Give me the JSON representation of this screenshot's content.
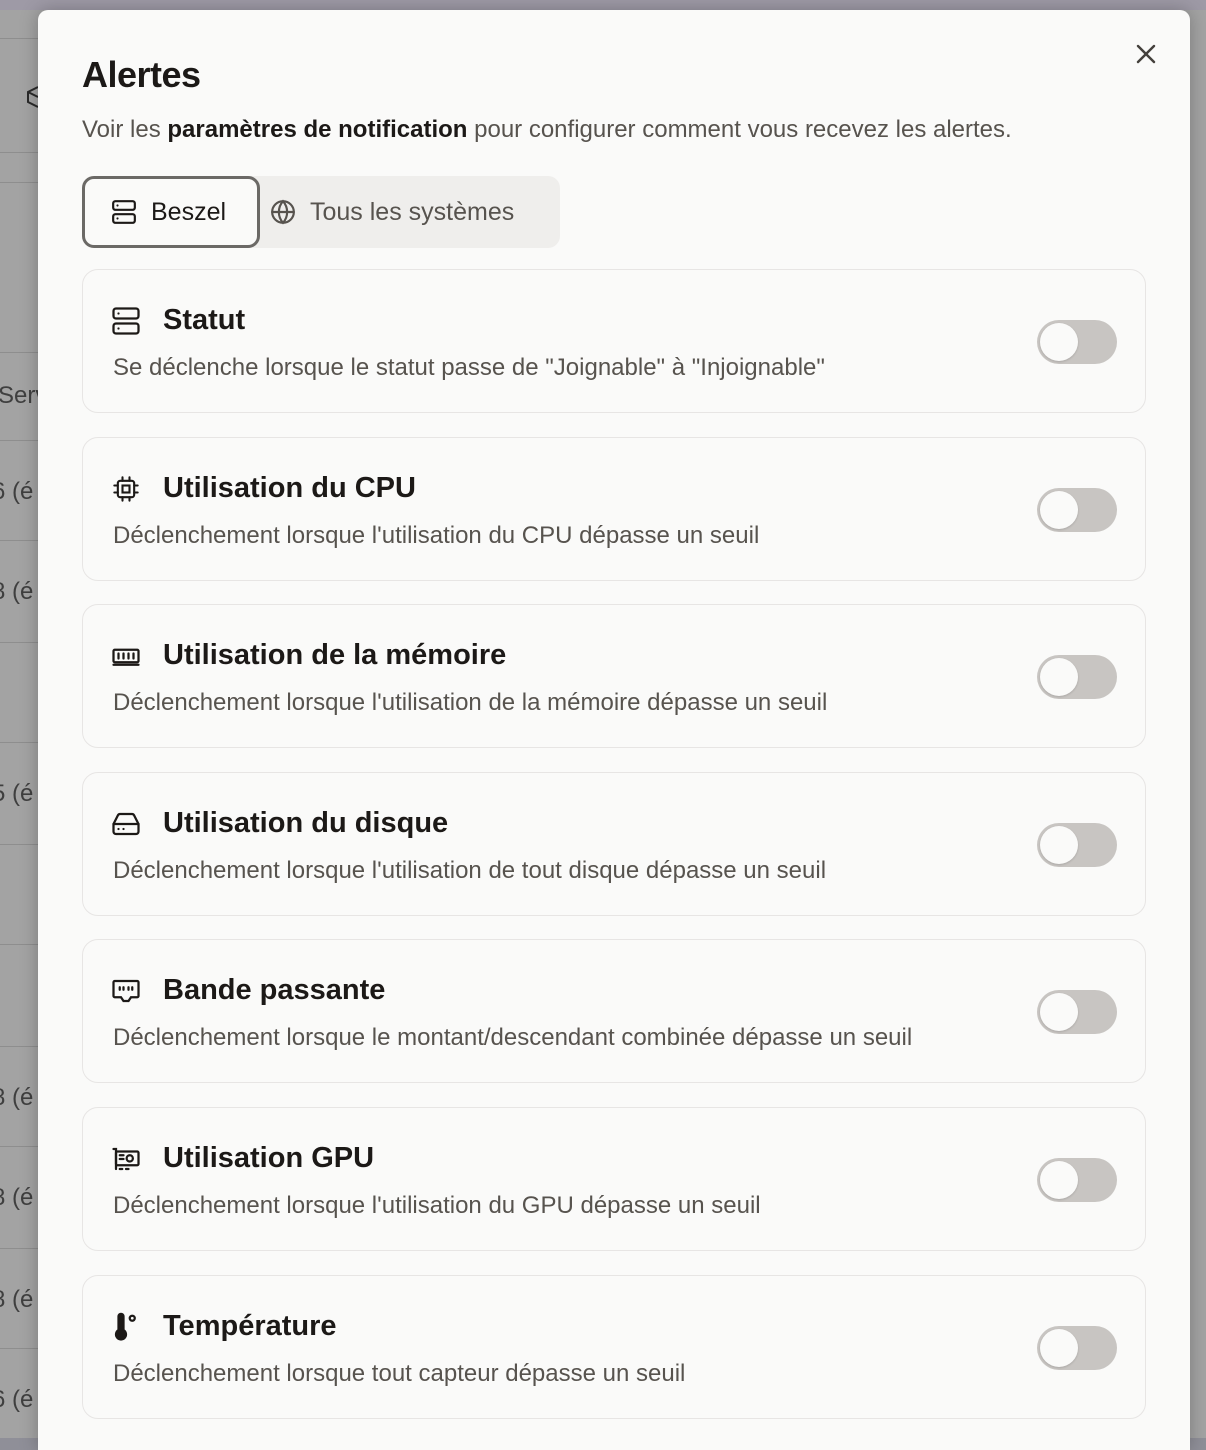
{
  "background": {
    "column_header_fragment": "Serv",
    "row_fragments": [
      "6 (é",
      "8 (é",
      "5 (é",
      "8 (é",
      "8 (é",
      "8 (é",
      "6 (é"
    ]
  },
  "modal": {
    "title": "Alertes",
    "subtitle": {
      "prefix": "Voir les ",
      "link": "paramètres de notification",
      "suffix": " pour configurer comment vous recevez les alertes."
    },
    "tabs": [
      {
        "label": "Beszel",
        "icon": "server-icon",
        "active": true
      },
      {
        "label": "Tous les systèmes",
        "icon": "globe-icon",
        "active": false
      }
    ],
    "alerts": [
      {
        "icon": "server-icon",
        "title": "Statut",
        "description": "Se déclenche lorsque le statut passe de \"Joignable\" à \"Injoignable\"",
        "enabled": false
      },
      {
        "icon": "cpu-icon",
        "title": "Utilisation du CPU",
        "description": "Déclenchement lorsque l'utilisation du CPU dépasse un seuil",
        "enabled": false
      },
      {
        "icon": "memory-icon",
        "title": "Utilisation de la mémoire",
        "description": "Déclenchement lorsque l'utilisation de la mémoire dépasse un seuil",
        "enabled": false
      },
      {
        "icon": "hard-drive-icon",
        "title": "Utilisation du disque",
        "description": "Déclenchement lorsque l'utilisation de tout disque dépasse un seuil",
        "enabled": false
      },
      {
        "icon": "ethernet-port-icon",
        "title": "Bande passante",
        "description": "Déclenchement lorsque le montant/descendant combinée dépasse un seuil",
        "enabled": false
      },
      {
        "icon": "gpu-icon",
        "title": "Utilisation GPU",
        "description": "Déclenchement lorsque l'utilisation du GPU dépasse un seuil",
        "enabled": false
      },
      {
        "icon": "thermometer-icon",
        "title": "Température",
        "description": "Déclenchement lorsque tout capteur dépasse un seuil",
        "enabled": false
      }
    ]
  },
  "colors": {
    "toggle_off": "#c8c5c2",
    "text_primary": "#1c1917",
    "text_muted": "#57534e"
  }
}
